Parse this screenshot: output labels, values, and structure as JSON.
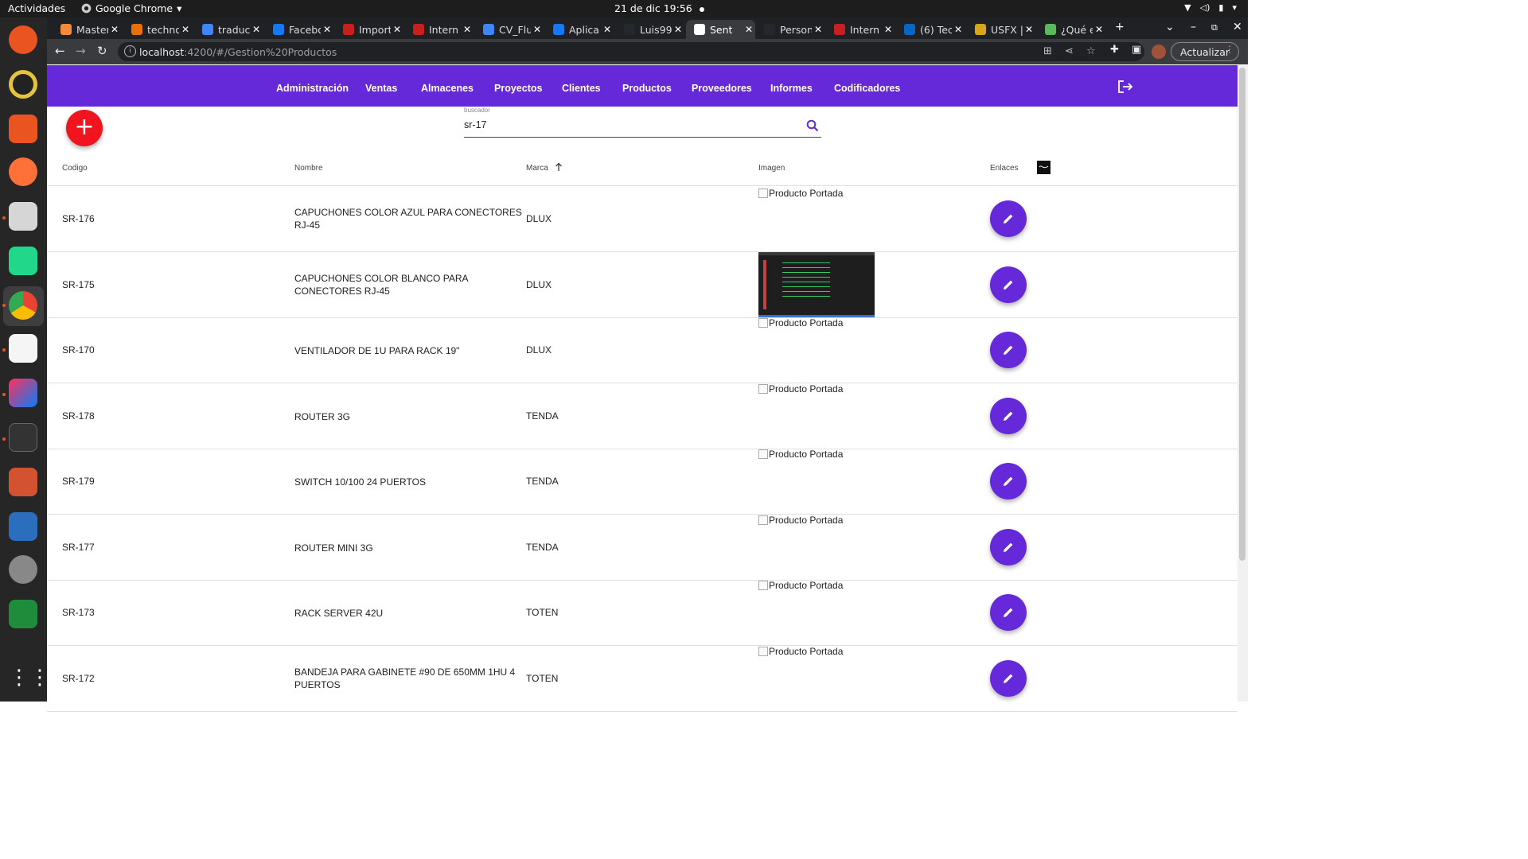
{
  "os": {
    "activities": "Actividades",
    "app_name": "Google Chrome",
    "clock": "21 de dic  19:56"
  },
  "browser": {
    "tabs": [
      {
        "title": "Master",
        "color": "#f48a3a"
      },
      {
        "title": "technol",
        "color": "#e8710a"
      },
      {
        "title": "traduct",
        "color": "#4285f4"
      },
      {
        "title": "Facebo",
        "color": "#1877f2"
      },
      {
        "title": "Import",
        "color": "#c5221f"
      },
      {
        "title": "Intern",
        "color": "#c5221f"
      },
      {
        "title": "CV_Flu",
        "color": "#4285f4"
      },
      {
        "title": "Aplica",
        "color": "#1877f2"
      },
      {
        "title": "Luis99",
        "color": "#24292e"
      },
      {
        "title": "Sent",
        "color": "#ffffff"
      },
      {
        "title": "Person",
        "color": "#24292e"
      },
      {
        "title": "Intern",
        "color": "#c5221f"
      },
      {
        "title": "(6) Tec",
        "color": "#0a66c2"
      },
      {
        "title": "USFX |",
        "color": "#d9a520"
      },
      {
        "title": "¿Qué e",
        "color": "#5cb85c"
      }
    ],
    "url_host": "localhost",
    "url_path": ":4200/#/Gestion%20Productos",
    "update_label": "Actualizar"
  },
  "nav": {
    "items": [
      "Administración",
      "Ventas",
      "Almacenes",
      "Proyectos",
      "Clientes",
      "Productos",
      "Proveedores",
      "Informes",
      "Codificadores"
    ]
  },
  "search": {
    "label": "buscador",
    "value": "sr-17"
  },
  "table": {
    "headers": {
      "code": "Codigo",
      "name": "Nombre",
      "brand": "Marca",
      "image": "Imagen",
      "links": "Enlaces"
    },
    "image_alt": "Producto Portada",
    "rows": [
      {
        "code": "SR-176",
        "name": "CAPUCHONES COLOR AZUL PARA CONECTORES RJ-45",
        "brand": "DLUX",
        "image": "broken"
      },
      {
        "code": "SR-175",
        "name": "CAPUCHONES COLOR BLANCO PARA CONECTORES RJ-45",
        "brand": "DLUX",
        "image": "screenshot"
      },
      {
        "code": "SR-170",
        "name": "VENTILADOR DE 1U PARA RACK 19\"",
        "brand": "DLUX",
        "image": "broken"
      },
      {
        "code": "SR-178",
        "name": "ROUTER 3G",
        "brand": "TENDA",
        "image": "broken"
      },
      {
        "code": "SR-179",
        "name": "SWITCH 10/100 24 PUERTOS",
        "brand": "TENDA",
        "image": "broken"
      },
      {
        "code": "SR-177",
        "name": "ROUTER MINI 3G",
        "brand": "TENDA",
        "image": "broken"
      },
      {
        "code": "SR-173",
        "name": "RACK SERVER 42U",
        "brand": "TOTEN",
        "image": "broken"
      },
      {
        "code": "SR-172",
        "name": "BANDEJA PARA GABINETE #90 DE 650MM 1HU 4 PUERTOS",
        "brand": "TOTEN",
        "image": "broken"
      }
    ]
  },
  "colors": {
    "primary": "#6629d9",
    "fab": "#f0141e"
  }
}
